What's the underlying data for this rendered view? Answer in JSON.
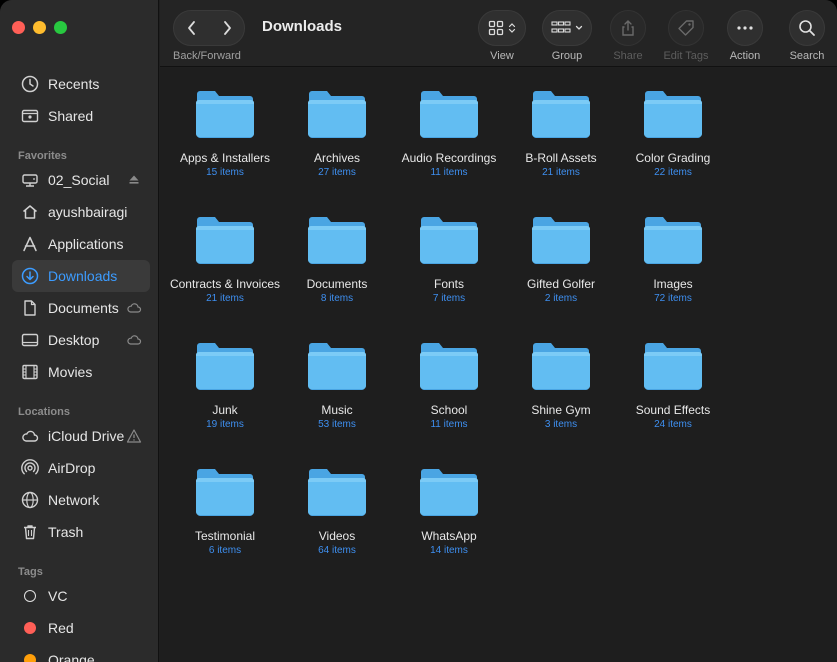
{
  "window": {
    "title": "Downloads"
  },
  "toolbar": {
    "nav_label": "Back/Forward",
    "view_label": "View",
    "group_label": "Group",
    "share_label": "Share",
    "edit_tags_label": "Edit Tags",
    "action_label": "Action",
    "search_label": "Search"
  },
  "sidebar": {
    "top_items": [
      {
        "label": "Recents",
        "icon": "clock-icon"
      },
      {
        "label": "Shared",
        "icon": "shared-folder-icon"
      }
    ],
    "favorites_title": "Favorites",
    "favorites": [
      {
        "label": "02_Social",
        "icon": "drive-icon",
        "trail": "eject-icon"
      },
      {
        "label": "ayushbairagi",
        "icon": "home-icon"
      },
      {
        "label": "Applications",
        "icon": "applications-icon"
      },
      {
        "label": "Downloads",
        "icon": "download-icon",
        "active": true
      },
      {
        "label": "Documents",
        "icon": "document-icon",
        "trail": "cloud-icon"
      },
      {
        "label": "Desktop",
        "icon": "desktop-icon",
        "trail": "cloud-icon"
      },
      {
        "label": "Movies",
        "icon": "film-icon"
      }
    ],
    "locations_title": "Locations",
    "locations": [
      {
        "label": "iCloud Drive",
        "icon": "cloud-icon",
        "trail": "warning-icon"
      },
      {
        "label": "AirDrop",
        "icon": "airdrop-icon"
      },
      {
        "label": "Network",
        "icon": "globe-icon"
      },
      {
        "label": "Trash",
        "icon": "trash-icon"
      }
    ],
    "tags_title": "Tags",
    "tags": [
      {
        "label": "VC",
        "color": ""
      },
      {
        "label": "Red",
        "color": "#ff5f57"
      },
      {
        "label": "Orange",
        "color": "#ff9f0a"
      }
    ]
  },
  "folders": [
    {
      "name": "Apps & Installers",
      "count": "15 items"
    },
    {
      "name": "Archives",
      "count": "27 items"
    },
    {
      "name": "Audio Recordings",
      "count": "11 items"
    },
    {
      "name": "B-Roll Assets",
      "count": "21 items"
    },
    {
      "name": "Color Grading",
      "count": "22 items"
    },
    {
      "name": "Contracts & Invoices",
      "count": "21 items"
    },
    {
      "name": "Documents",
      "count": "8 items"
    },
    {
      "name": "Fonts",
      "count": "7 items"
    },
    {
      "name": "Gifted Golfer",
      "count": "2 items"
    },
    {
      "name": "Images",
      "count": "72 items"
    },
    {
      "name": "Junk",
      "count": "19 items"
    },
    {
      "name": "Music",
      "count": "53 items"
    },
    {
      "name": "School",
      "count": "11 items"
    },
    {
      "name": "Shine Gym",
      "count": "3 items"
    },
    {
      "name": "Sound Effects",
      "count": "24 items"
    },
    {
      "name": "Testimonial",
      "count": "6 items"
    },
    {
      "name": "Videos",
      "count": "64 items"
    },
    {
      "name": "WhatsApp",
      "count": "14 items"
    }
  ],
  "colors": {
    "accent": "#3c9cff",
    "folder": "#5ab4ee",
    "item_count": "#3e8ff0"
  }
}
